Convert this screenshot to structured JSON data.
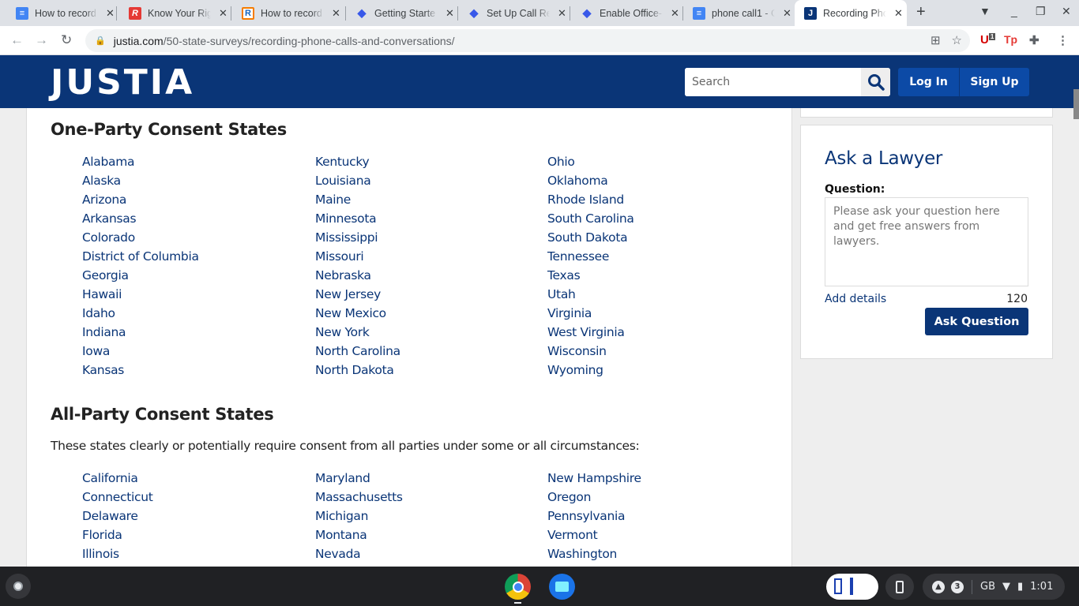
{
  "browser": {
    "tabs": [
      {
        "title": "How to record",
        "favicon": "google-docs-icon",
        "active": false
      },
      {
        "title": "Know Your Rig",
        "favicon": "r-red-icon",
        "active": false
      },
      {
        "title": "How to record",
        "favicon": "r-orange-icon",
        "active": false
      },
      {
        "title": "Getting Starte",
        "favicon": "dialpad-icon",
        "active": false
      },
      {
        "title": "Set Up Call Re",
        "favicon": "dialpad-icon",
        "active": false
      },
      {
        "title": "Enable Office-",
        "favicon": "dialpad-icon",
        "active": false
      },
      {
        "title": "phone call1 - G",
        "favicon": "google-docs-icon",
        "active": false
      },
      {
        "title": "Recording Pho",
        "favicon": "justia-icon",
        "active": true
      }
    ],
    "url_host": "justia.com",
    "url_path": "/50-state-surveys/recording-phone-calls-and-conversations/",
    "extension_badge": "1",
    "extension_tp": "Tp"
  },
  "header": {
    "logo": "JUSTIA",
    "search_placeholder": "Search",
    "login_label": "Log In",
    "signup_label": "Sign Up"
  },
  "main": {
    "one_party": {
      "heading": "One-Party Consent States",
      "columns": [
        [
          "Alabama",
          "Alaska",
          "Arizona",
          "Arkansas",
          "Colorado",
          "District of Columbia",
          "Georgia",
          "Hawaii",
          "Idaho",
          "Indiana",
          "Iowa",
          "Kansas"
        ],
        [
          "Kentucky",
          "Louisiana",
          "Maine",
          "Minnesota",
          "Mississippi",
          "Missouri",
          "Nebraska",
          "New Jersey",
          "New Mexico",
          "New York",
          "North Carolina",
          "North Dakota"
        ],
        [
          "Ohio",
          "Oklahoma",
          "Rhode Island",
          "South Carolina",
          "South Dakota",
          "Tennessee",
          "Texas",
          "Utah",
          "Virginia",
          "West Virginia",
          "Wisconsin",
          "Wyoming"
        ]
      ]
    },
    "all_party": {
      "heading": "All-Party Consent States",
      "intro": "These states clearly or potentially require consent from all parties under some or all circumstances:",
      "columns": [
        [
          "California",
          "Connecticut",
          "Delaware",
          "Florida",
          "Illinois"
        ],
        [
          "Maryland",
          "Massachusetts",
          "Michigan",
          "Montana",
          "Nevada"
        ],
        [
          "New Hampshire",
          "Oregon",
          "Pennsylvania",
          "Vermont",
          "Washington"
        ]
      ]
    }
  },
  "sidebar": {
    "ask_title": "Ask a Lawyer",
    "question_label": "Question:",
    "question_placeholder": "Please ask your question here and get free answers from lawyers.",
    "add_details": "Add details",
    "char_count": "120",
    "ask_button": "Ask Question"
  },
  "shelf": {
    "notification_count": "3",
    "keyboard_layout": "GB",
    "time": "1:01"
  },
  "colors": {
    "brand": "#0a3577",
    "button": "#0c4aa6",
    "link": "#0a3577"
  }
}
